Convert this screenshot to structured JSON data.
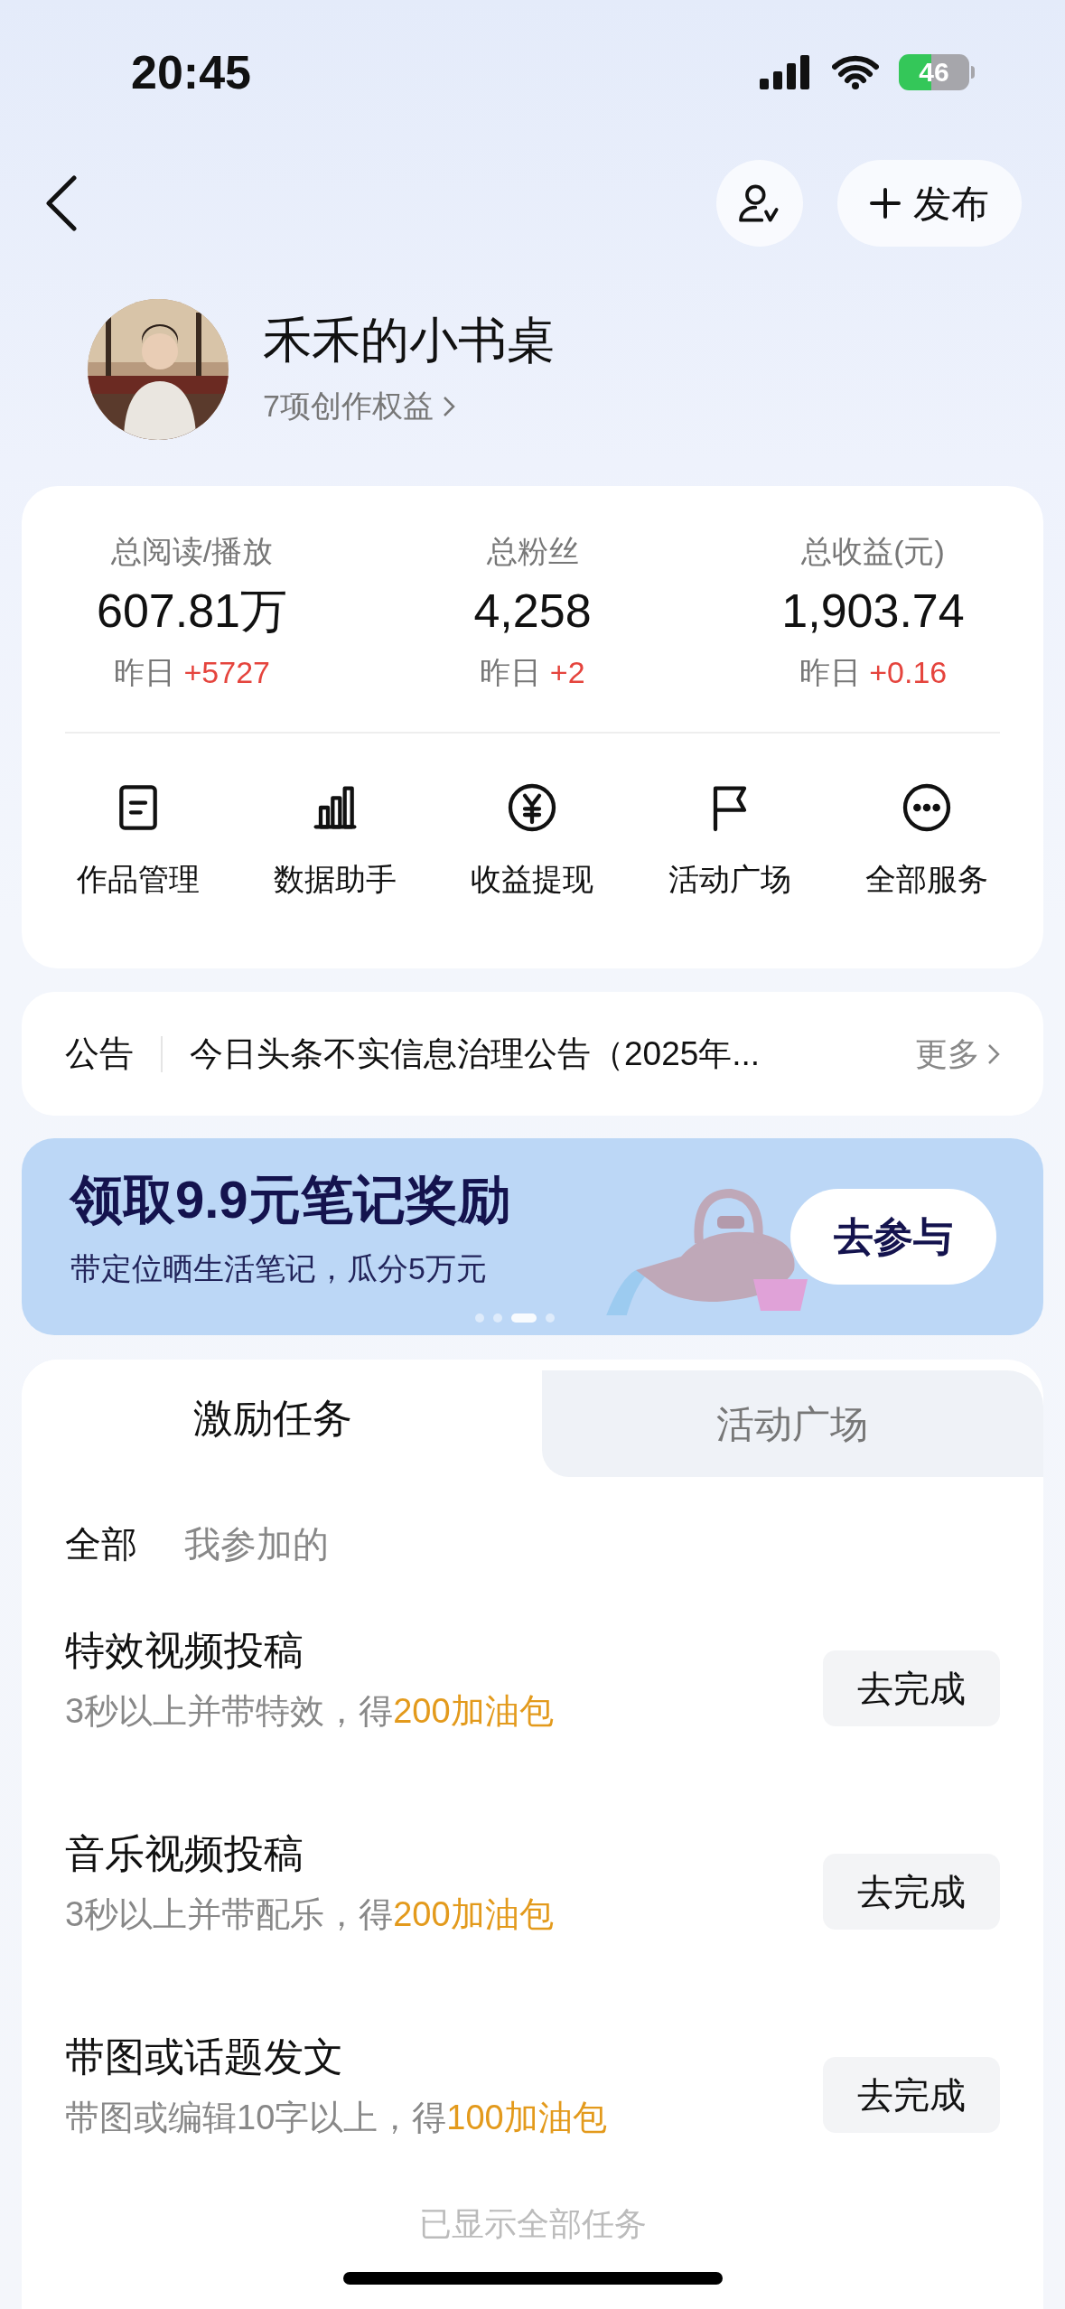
{
  "status_bar": {
    "time": "20:45",
    "battery": "46"
  },
  "header": {
    "publish_button": "发布"
  },
  "profile": {
    "name": "禾禾的小书桌",
    "benefits": "7项创作权益"
  },
  "stats": [
    {
      "label": "总阅读/播放",
      "value": "607.81万",
      "yesterday_label": "昨日",
      "yesterday_change": "+5727"
    },
    {
      "label": "总粉丝",
      "value": "4,258",
      "yesterday_label": "昨日",
      "yesterday_change": "+2"
    },
    {
      "label": "总收益(元)",
      "value": "1,903.74",
      "yesterday_label": "昨日",
      "yesterday_change": "+0.16"
    }
  ],
  "services": [
    {
      "kind": "document",
      "label": "作品管理"
    },
    {
      "kind": "chart",
      "label": "数据助手"
    },
    {
      "kind": "yen",
      "label": "收益提现"
    },
    {
      "kind": "flag",
      "label": "活动广场"
    },
    {
      "kind": "more",
      "label": "全部服务"
    }
  ],
  "notice": {
    "label": "公告",
    "text": "今日头条不实信息治理公告（2025年...",
    "more": "更多"
  },
  "banner": {
    "title": "领取9.9元笔记奖励",
    "subtitle": "带定位晒生活笔记，瓜分5万元",
    "button": "去参与",
    "pager": [
      {
        "selected": false
      },
      {
        "selected": false
      },
      {
        "selected": true
      },
      {
        "selected": false
      }
    ]
  },
  "tabs": [
    {
      "label": "激励任务",
      "selected": true
    },
    {
      "label": "活动广场",
      "selected": false
    }
  ],
  "filters": [
    {
      "label": "全部",
      "selected": true
    },
    {
      "label": "我参加的",
      "selected": false
    }
  ],
  "tasks": [
    {
      "title": "特效视频投稿",
      "description": "3秒以上并带特效，得",
      "reward": "200加油包",
      "button": "去完成"
    },
    {
      "title": "音乐视频投稿",
      "description": "3秒以上并带配乐，得",
      "reward": "200加油包",
      "button": "去完成"
    },
    {
      "title": "带图或话题发文",
      "description": "带图或编辑10字以上，得",
      "reward": "100加油包",
      "button": "去完成"
    }
  ],
  "footer": "已显示全部任务"
}
